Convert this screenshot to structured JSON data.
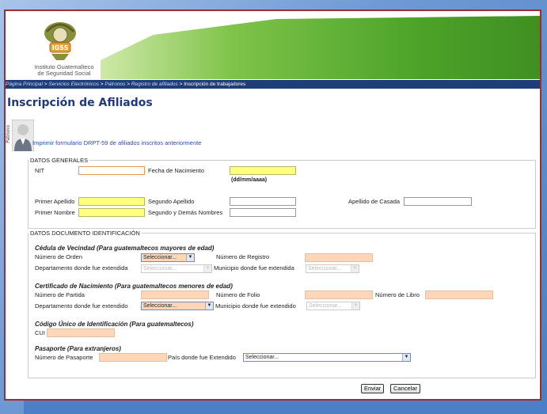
{
  "header": {
    "institution_line1": "Instituto Guatemalteco",
    "institution_line2": "de Seguridad Social",
    "logo_text": "IGSS"
  },
  "breadcrumb": {
    "items": [
      "Página Principal",
      "Servicios Electrónicos",
      "Patronos",
      "Registro de afiliados"
    ],
    "separator": " > ",
    "current": "Inscripción de trabajadores"
  },
  "page_title": "Inscripción de Afiliados",
  "sidebar_label": "Patrono",
  "print_link": "Imprimir formulario DRPT-59 de afiliados inscritos anteriormente",
  "datos_generales": {
    "legend": "DATOS GENERALES",
    "nit_label": "NIT",
    "fecha_label": "Fecha de Nacimiento",
    "fecha_hint": "(dd/mm/aaaa)",
    "primer_apellido_label": "Primer Apellido",
    "segundo_apellido_label": "Segundo Apellido",
    "apellido_casada_label": "Apellido de Casada",
    "primer_nombre_label": "Primer Nombre",
    "segundo_nombre_label": "Segundo y Demás Nombres"
  },
  "datos_documento": {
    "legend": "DATOS DOCUMENTO IDENTIFICACIÓN",
    "cedula_heading": "Cédula de Vecindad (Para guatemaltecos mayores de edad)",
    "numero_orden_label": "Número de Orden",
    "numero_registro_label": "Número de Registro",
    "depto_extendida_label": "Departamento donde fue extendida",
    "municipio_extendida_label": "Municipio donde fue extendida",
    "certificado_heading": "Certificado de Nacimiento (Para guatemaltecos menores de edad)",
    "numero_partida_label": "Número de Partida",
    "numero_folio_label": "Número de Folio",
    "numero_libro_label": "Número de Libro",
    "depto_extendido_label": "Departamento donde fue extendido",
    "municipio_extendido_label": "Municipio donde fue extendido",
    "cui_heading": "Código Único de Identificación (Para guatemaltecos)",
    "cui_label": "CUI",
    "pasaporte_heading": "Pasaporte (Para extranjeros)",
    "numero_pasaporte_label": "Número de Pasaporte",
    "pais_label": "País donde fue Extendido",
    "select_placeholder": "Seleccionar..."
  },
  "buttons": {
    "submit": "Enviar",
    "cancel": "Cancelar"
  },
  "colors": {
    "required_field": "#ffff80",
    "document_field": "#ffd7b8",
    "title": "#1f3b7a",
    "breadcrumb_bg": "#1f3d77",
    "frame_border": "#a32b2b"
  }
}
